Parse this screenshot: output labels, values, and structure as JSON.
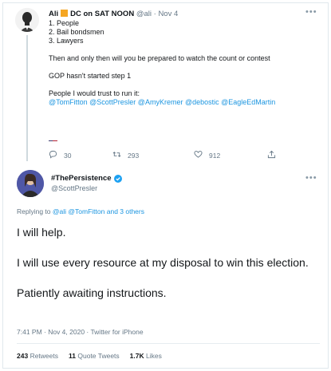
{
  "parent": {
    "name": "Ali",
    "name_suffix": "DC on SAT NOON",
    "handle": "@ali",
    "date": "Nov 4",
    "lines": [
      "1. People",
      "2. Bail bondsmen",
      "3. Lawyers",
      "",
      "Then and only then will you be prepared to watch the count or contest",
      "",
      "GOP hasn't started step 1",
      "",
      "People I would trust to run it:"
    ],
    "mentions": "@TomFitton @ScottPresler @AmyKremer @debostic @EagleEdMartin",
    "flag_icon": "us-flag-icon",
    "stats": {
      "replies": "30",
      "retweets": "293",
      "likes": "912"
    }
  },
  "main": {
    "name": "#ThePersistence",
    "handle": "@ScottPresler",
    "reply_prefix": "Replying to",
    "reply_targets": "@ali @TomFitton",
    "reply_suffix": "and 3 others",
    "body": [
      "I will help.",
      "",
      "I will use every resource at my disposal to win this election.",
      "",
      "Patiently awaiting instructions."
    ],
    "timestamp": "7:41 PM · Nov 4, 2020 · Twitter for iPhone",
    "retweets": "243",
    "retweets_label": "Retweets",
    "quotes": "11",
    "quotes_label": "Quote Tweets",
    "likes": "1.7K",
    "likes_label": "Likes"
  },
  "colors": {
    "link": "#1b95e0",
    "verified": "#1da1f2",
    "muted": "#657786",
    "orange_square": "#f5a623"
  }
}
